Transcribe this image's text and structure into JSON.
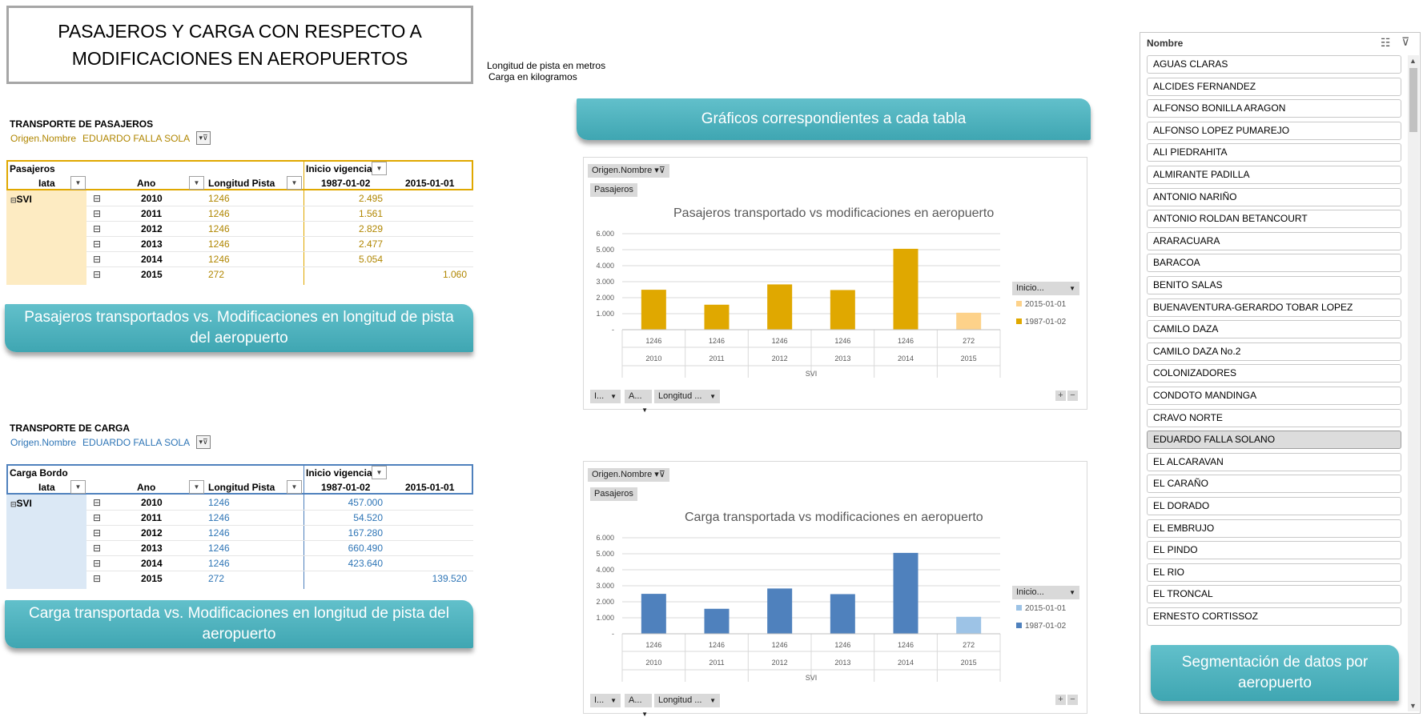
{
  "title": "PASAJEROS Y CARGA CON RESPECTO A MODIFICACIONES EN AEROPUERTOS",
  "notes": [
    "Longitud de pista en metros",
    "Carga en kilogramos"
  ],
  "colors": {
    "gold": "#e0a800",
    "gold_light": "#fdd28a",
    "blue": "#4f81bd",
    "blue_light": "#9dc3e6",
    "teal": "#4bb1bd"
  },
  "passenger_table": {
    "section_title": "TRANSPORTE DE PASAJEROS",
    "filter_label": "Origen.Nombre",
    "filter_value": "EDUARDO FALLA SOLA",
    "measure": "Pasajeros",
    "col_field": "Inicio vigencia",
    "headers": {
      "iata": "Iata",
      "ano": "Ano",
      "longitud": "Longitud Pista",
      "c1": "1987-01-02",
      "c2": "2015-01-01"
    },
    "iata_value": "SVI",
    "rows": [
      {
        "ano": "2010",
        "longitud": "1246",
        "c1": "2.495",
        "c2": ""
      },
      {
        "ano": "2011",
        "longitud": "1246",
        "c1": "1.561",
        "c2": ""
      },
      {
        "ano": "2012",
        "longitud": "1246",
        "c1": "2.829",
        "c2": ""
      },
      {
        "ano": "2013",
        "longitud": "1246",
        "c1": "2.477",
        "c2": ""
      },
      {
        "ano": "2014",
        "longitud": "1246",
        "c1": "5.054",
        "c2": ""
      },
      {
        "ano": "2015",
        "longitud": "272",
        "c1": "",
        "c2": "1.060"
      }
    ]
  },
  "cargo_table": {
    "section_title": "TRANSPORTE DE CARGA",
    "filter_label": "Origen.Nombre",
    "filter_value": "EDUARDO FALLA SOLA",
    "measure": "Carga Bordo",
    "col_field": "Inicio vigencia",
    "headers": {
      "iata": "Iata",
      "ano": "Ano",
      "longitud": "Longitud Pista",
      "c1": "1987-01-02",
      "c2": "2015-01-01"
    },
    "iata_value": "SVI",
    "rows": [
      {
        "ano": "2010",
        "longitud": "1246",
        "c1": "457.000",
        "c2": ""
      },
      {
        "ano": "2011",
        "longitud": "1246",
        "c1": "54.520",
        "c2": ""
      },
      {
        "ano": "2012",
        "longitud": "1246",
        "c1": "167.280",
        "c2": ""
      },
      {
        "ano": "2013",
        "longitud": "1246",
        "c1": "660.490",
        "c2": ""
      },
      {
        "ano": "2014",
        "longitud": "1246",
        "c1": "423.640",
        "c2": ""
      },
      {
        "ano": "2015",
        "longitud": "272",
        "c1": "",
        "c2": "139.520"
      }
    ]
  },
  "banners": {
    "passengers": "Pasajeros transportados vs. Modificaciones en longitud de pista del aeropuerto",
    "cargo": "Carga transportada vs. Modificaciones en longitud de pista del aeropuerto",
    "charts": "Gráficos correspondientes a cada tabla",
    "slicer": "Segmentación de datos por aeropuerto"
  },
  "chart_controls": {
    "filter_chip": "Origen.Nombre",
    "value_chip": "Pasajeros",
    "bottom_chips": [
      "I...",
      "A...",
      "Longitud ..."
    ],
    "legend_chip": "Inicio...",
    "zoom_plus": "+",
    "zoom_minus": "−"
  },
  "chart_data": [
    {
      "type": "bar",
      "title": "Pasajeros transportado vs modificaciones en aeropuerto",
      "categories": [
        "2010",
        "2011",
        "2012",
        "2013",
        "2014",
        "2015"
      ],
      "category_sublabels": [
        "1246",
        "1246",
        "1246",
        "1246",
        "1246",
        "272"
      ],
      "group_label": "SVI",
      "series": [
        {
          "name": "1987-01-02",
          "color": "#e0a800",
          "values": [
            2495,
            1561,
            2829,
            2477,
            5054,
            null
          ]
        },
        {
          "name": "2015-01-01",
          "color": "#fdd28a",
          "values": [
            null,
            null,
            null,
            null,
            null,
            1060
          ]
        }
      ],
      "ylim": [
        0,
        6000
      ],
      "yticks": [
        "6.000",
        "5.000",
        "4.000",
        "3.000",
        "2.000",
        "1.000",
        "-"
      ],
      "legend": "right",
      "grid": true
    },
    {
      "type": "bar",
      "title": "Carga transportada vs modificaciones en aeropuerto",
      "categories": [
        "2010",
        "2011",
        "2012",
        "2013",
        "2014",
        "2015"
      ],
      "category_sublabels": [
        "1246",
        "1246",
        "1246",
        "1246",
        "1246",
        "272"
      ],
      "group_label": "SVI",
      "series": [
        {
          "name": "1987-01-02",
          "color": "#4f81bd",
          "values": [
            2495,
            1561,
            2829,
            2477,
            5054,
            null
          ]
        },
        {
          "name": "2015-01-01",
          "color": "#9dc3e6",
          "values": [
            null,
            null,
            null,
            null,
            null,
            1060
          ]
        }
      ],
      "ylim": [
        0,
        6000
      ],
      "yticks": [
        "6.000",
        "5.000",
        "4.000",
        "3.000",
        "2.000",
        "1.000",
        "-"
      ],
      "legend": "right",
      "grid": true
    }
  ],
  "slicer": {
    "header": "Nombre",
    "items": [
      "AGUAS CLARAS",
      "ALCIDES FERNANDEZ",
      "ALFONSO BONILLA ARAGON",
      "ALFONSO LOPEZ PUMAREJO",
      "ALI PIEDRAHITA",
      "ALMIRANTE PADILLA",
      "ANTONIO NARIÑO",
      "ANTONIO ROLDAN BETANCOURT",
      "ARARACUARA",
      "BARACOA",
      "BENITO SALAS",
      "BUENAVENTURA-GERARDO TOBAR LOPEZ",
      "CAMILO DAZA",
      "CAMILO DAZA No.2",
      "COLONIZADORES",
      "CONDOTO MANDINGA",
      "CRAVO NORTE",
      "EDUARDO FALLA SOLANO",
      "EL ALCARAVAN",
      "EL CARAÑO",
      "EL DORADO",
      "EL EMBRUJO",
      "EL PINDO",
      "EL RIO",
      "EL TRONCAL",
      "ERNESTO CORTISSOZ"
    ],
    "selected": "EDUARDO FALLA SOLANO"
  }
}
